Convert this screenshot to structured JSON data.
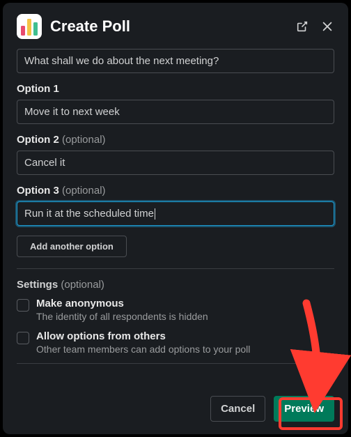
{
  "header": {
    "title": "Create Poll"
  },
  "question": {
    "value": "What shall we do about the next meeting?"
  },
  "options": [
    {
      "label": "Option 1",
      "optional": "",
      "value": "Move it to next week",
      "focused": false
    },
    {
      "label": "Option 2",
      "optional": "(optional)",
      "value": "Cancel it",
      "focused": false
    },
    {
      "label": "Option 3",
      "optional": "(optional)",
      "value": "Run it at the scheduled time",
      "focused": true
    }
  ],
  "add_option_label": "Add another option",
  "settings": {
    "label": "Settings",
    "optional": "(optional)",
    "items": [
      {
        "title": "Make anonymous",
        "desc": "The identity of all respondents is hidden"
      },
      {
        "title": "Allow options from others",
        "desc": "Other team members can add options to your poll"
      }
    ]
  },
  "footer": {
    "cancel": "Cancel",
    "preview": "Preview"
  },
  "annotation": {
    "color": "#ff3b30"
  }
}
